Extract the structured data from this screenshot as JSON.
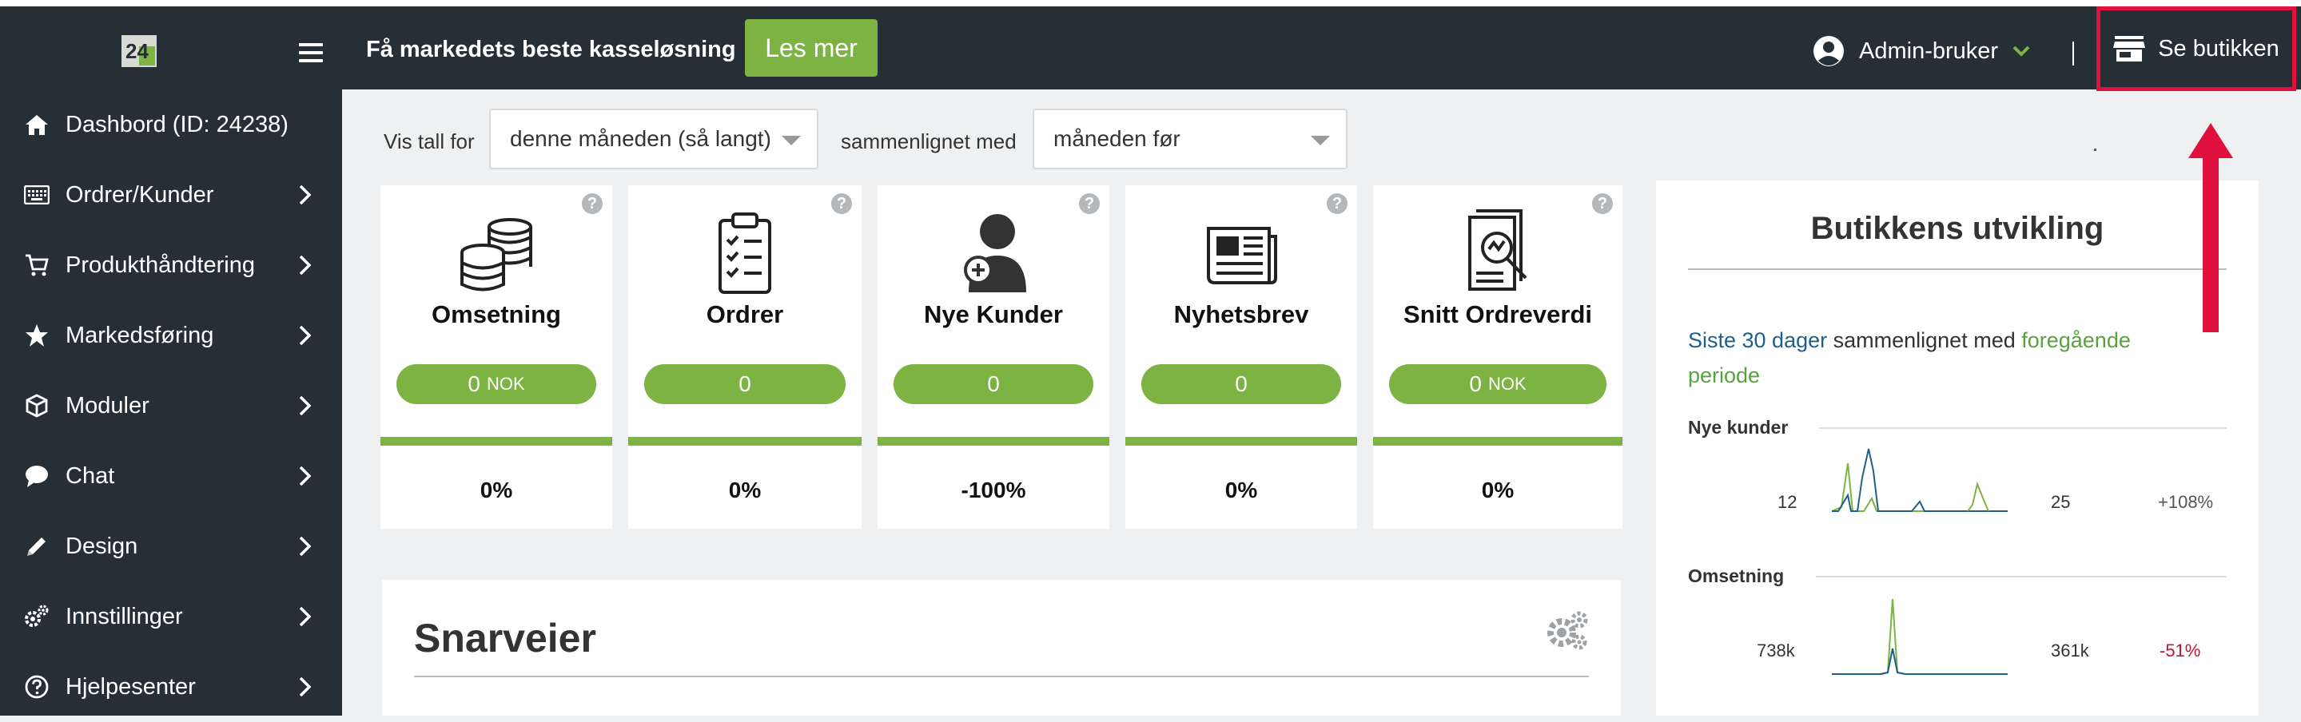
{
  "topbar": {
    "logo_text": "24",
    "promo_text": "Få markedets beste kasseløsning",
    "les_mer_label": "Les mer",
    "admin_label": "Admin-bruker",
    "se_butikken_label": "Se butikken",
    "accent_color": "#7cb342",
    "highlight_color": "#e0113d"
  },
  "sidebar": {
    "items": [
      {
        "label": "Dashbord (ID: 24238)",
        "icon": "home-icon"
      },
      {
        "label": "Ordrer/Kunder",
        "icon": "keyboard-icon"
      },
      {
        "label": "Produkthåndtering",
        "icon": "cart-icon"
      },
      {
        "label": "Markedsføring",
        "icon": "star-icon"
      },
      {
        "label": "Moduler",
        "icon": "cube-icon"
      },
      {
        "label": "Chat",
        "icon": "chat-icon"
      },
      {
        "label": "Design",
        "icon": "pencil-icon"
      },
      {
        "label": "Innstillinger",
        "icon": "gears-icon"
      },
      {
        "label": "Hjelpesenter",
        "icon": "help-circle-icon"
      }
    ]
  },
  "filters": {
    "vis_tall_for_label": "Vis tall for",
    "period_value": "denne måneden (så langt)",
    "compare_label": "sammenlignet med",
    "compare_value": "måneden før"
  },
  "cards": [
    {
      "title": "Omsetning",
      "value": "0",
      "unit": "NOK",
      "change": "0%",
      "icon": "coins-icon"
    },
    {
      "title": "Ordrer",
      "value": "0",
      "unit": "",
      "change": "0%",
      "icon": "clipboard-icon"
    },
    {
      "title": "Nye Kunder",
      "value": "0",
      "unit": "",
      "change": "-100%",
      "icon": "user-add-icon"
    },
    {
      "title": "Nyhetsbrev",
      "value": "0",
      "unit": "",
      "change": "0%",
      "icon": "newspaper-icon"
    },
    {
      "title": "Snitt Ordreverdi",
      "value": "0",
      "unit": "NOK",
      "change": "0%",
      "icon": "report-search-icon"
    }
  ],
  "help_glyph": "?",
  "snarveier": {
    "title": "Snarveier"
  },
  "panel": {
    "title": "Butikkens utvikling",
    "desc_part1": "Siste 30 dager",
    "desc_part2": " sammenlignet med ",
    "desc_part3": "foregående periode",
    "metrics": [
      {
        "name": "Nye kunder",
        "current": "12",
        "previous": "25",
        "change": "+108%",
        "change_color": "#555555"
      },
      {
        "name": "Omsetning",
        "current": "738k",
        "previous": "361k",
        "change": "-51%",
        "change_color": "#c0152f"
      }
    ],
    "series_colors": {
      "current": "#1f5f8b",
      "previous": "#7cb342"
    }
  }
}
